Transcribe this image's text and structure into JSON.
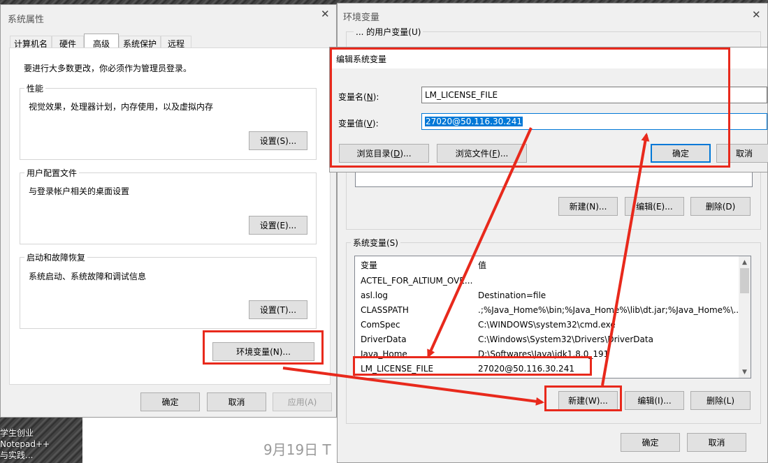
{
  "desktop": {
    "taskbar_text1": "学生创业 Notepad++",
    "taskbar_text2": "与实践...",
    "date_text": "9月19日 T"
  },
  "sys_props": {
    "title": "系统属性",
    "tabs": [
      "计算机名",
      "硬件",
      "高级",
      "系统保护",
      "远程"
    ],
    "admin_note": "要进行大多数更改，你必须作为管理员登录。",
    "perf": {
      "label": "性能",
      "desc": "视觉效果，处理器计划，内存使用，以及虚拟内存",
      "button": "设置(S)..."
    },
    "profile": {
      "label": "用户配置文件",
      "desc": "与登录帐户相关的桌面设置",
      "button": "设置(E)..."
    },
    "startup": {
      "label": "启动和故障恢复",
      "desc": "系统启动、系统故障和调试信息",
      "button": "设置(T)..."
    },
    "env_button": "环境变量(N)...",
    "ok": "确定",
    "cancel": "取消",
    "apply": "应用(A)"
  },
  "env_vars": {
    "title": "环境变量",
    "user_section_partial": "... 的用户变量(U)",
    "user_buttons": {
      "new": "新建(N)...",
      "edit": "编辑(E)...",
      "delete": "删除(D)"
    },
    "sys_section": "系统变量(S)",
    "columns": {
      "var": "变量",
      "val": "值"
    },
    "rows": [
      {
        "var": "ACTEL_FOR_ALTIUM_OVE...",
        "val": ""
      },
      {
        "var": "asl.log",
        "val": "Destination=file"
      },
      {
        "var": "CLASSPATH",
        "val": ".;%Java_Home%\\bin;%Java_Home%\\lib\\dt.jar;%Java_Home%\\..."
      },
      {
        "var": "ComSpec",
        "val": "C:\\WINDOWS\\system32\\cmd.exe"
      },
      {
        "var": "DriverData",
        "val": "C:\\Windows\\System32\\Drivers\\DriverData"
      },
      {
        "var": "Java_Home",
        "val": "D:\\Softwares\\Java\\jdk1.8.0_191"
      },
      {
        "var": "LM_LICENSE_FILE",
        "val": "27020@50.116.30.241"
      }
    ],
    "sys_buttons": {
      "new": "新建(W)...",
      "edit": "编辑(I)...",
      "delete": "删除(L)"
    },
    "ok": "确定",
    "cancel": "取消"
  },
  "edit_var": {
    "title": "编辑系统变量",
    "name_label": "变量名(N):",
    "name_value": "LM_LICENSE_FILE",
    "value_label": "变量值(V):",
    "value_value": "27020@50.116.30.241",
    "browse_dir": "浏览目录(D)...",
    "browse_file": "浏览文件(F)...",
    "ok": "确定",
    "cancel": "取消"
  },
  "colors": {
    "annotation_red": "#e8291c",
    "selection_blue": "#0078d7"
  }
}
